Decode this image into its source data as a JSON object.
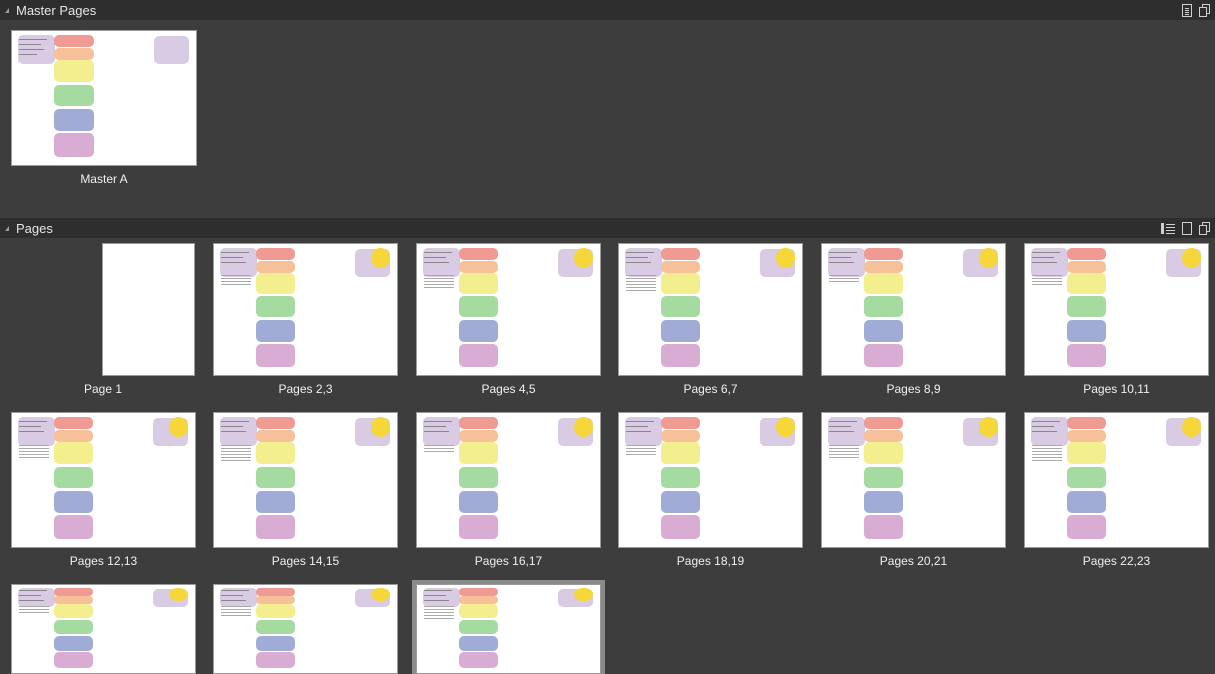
{
  "master_section": {
    "title": "Master Pages",
    "items": [
      {
        "label": "Master A"
      }
    ]
  },
  "pages_section": {
    "title": "Pages",
    "items": [
      {
        "label": "Page 1"
      },
      {
        "label": "Pages 2,3"
      },
      {
        "label": "Pages 4,5"
      },
      {
        "label": "Pages 6,7"
      },
      {
        "label": "Pages 8,9"
      },
      {
        "label": "Pages 10,11"
      },
      {
        "label": "Pages 12,13"
      },
      {
        "label": "Pages 14,15"
      },
      {
        "label": "Pages 16,17"
      },
      {
        "label": "Pages 18,19"
      },
      {
        "label": "Pages 20,21"
      },
      {
        "label": "Pages 22,23"
      }
    ]
  },
  "colors": {
    "panel_bg": "#3d3d3d",
    "header_bg": "#2e2e2e",
    "red": "#ef9a93",
    "orange": "#f6c098",
    "yellow": "#f3ef8e",
    "green": "#a5dba1",
    "blue": "#a0acd6",
    "pink": "#d8acd3",
    "lavender": "#d9cbe3"
  }
}
